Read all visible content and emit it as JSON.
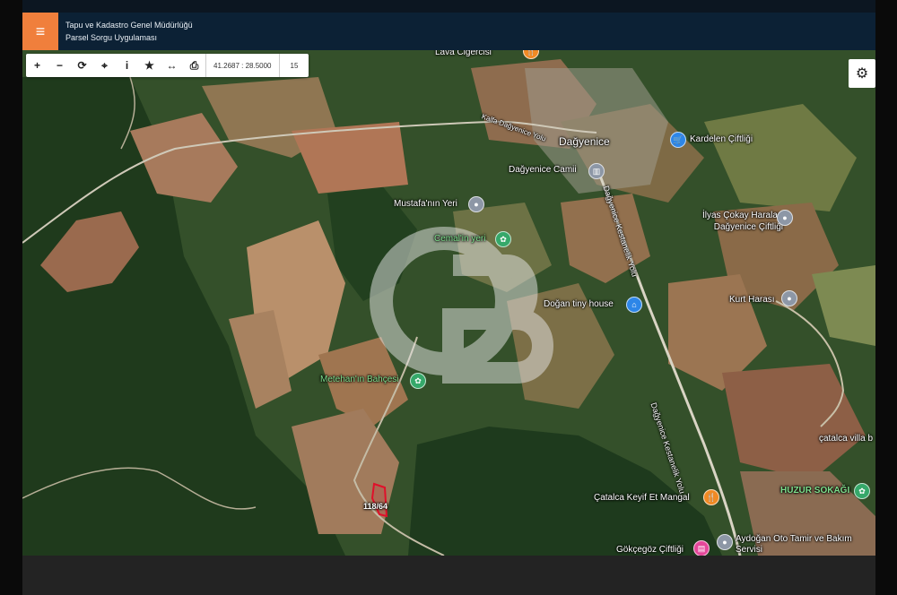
{
  "header": {
    "menu_icon": "≡",
    "org_title": "Tapu ve Kadastro Genel Müdürlüğü",
    "app_title": "Parsel Sorgu Uygulaması"
  },
  "toolbar": {
    "zoom_in": "+",
    "zoom_out": "−",
    "refresh": "⟳",
    "locate": "⌖",
    "info": "i",
    "favorite": "★",
    "measure": "↔",
    "print": "⎙",
    "coordinates": "41.2687 : 28.5000",
    "zoom_level": "15"
  },
  "settings_icon": "⚙",
  "labels": {
    "lava_cigercisi": "Lava Ciğercisi",
    "kalfa_road": "Kalfa Dağyenice Yolu",
    "dagyenice": "Dağyenice",
    "kardelen": "Kardelen Çiftliği",
    "dagyenice_camii": "Dağyenice Camii",
    "mustafa": "Mustafa'nın Yeri",
    "cemalin": "Cemal'in yeri",
    "ilyas": "İlyas Çokay Haraları Dağyenice Çiftliği",
    "dogan": "Doğan tiny house",
    "kurt": "Kurt Harası",
    "metehan": "Metehan'ın Bahçesi",
    "dk_yolu_upper": "Dağyenice Kestanelik Yolu",
    "dk_yolu_lower": "Dağyenice Kestanelik Yolu",
    "catalca_villa": "çatalca villa b",
    "huzur": "HUZUR SOKAĞI",
    "catalca_keyif": "Çatalca Keyif Et Mangal",
    "gokcegoz": "Gökçegöz Çiftliği",
    "aydogan": "Aydoğan Oto Tamir ve Bakım Servisi",
    "parcel": "118/64"
  },
  "colors": {
    "header_bg": "#0c2135",
    "menu_bg": "#f07f3c",
    "parcel_border": "#e0102a",
    "pin_gray": "#8d97a6",
    "pin_blue": "#2d86e8",
    "pin_green": "#36a86a",
    "pin_orange": "#f08a24",
    "pin_pink": "#e4479a"
  }
}
